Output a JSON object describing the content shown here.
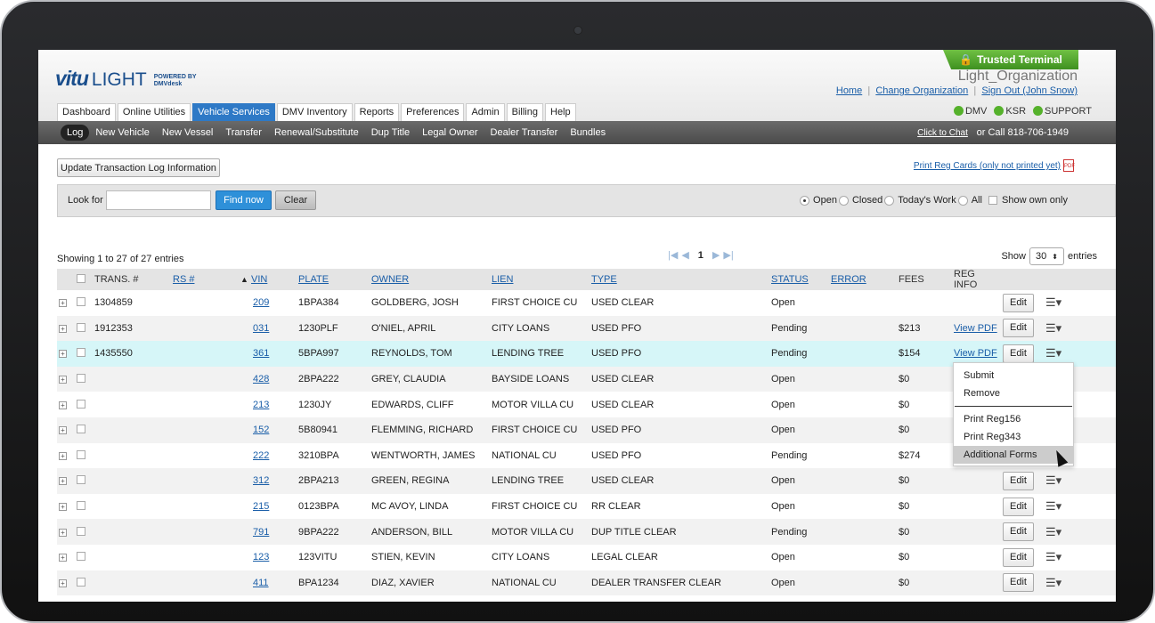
{
  "header": {
    "logo_main": "vitu",
    "logo_light": "LIGHT",
    "logo_powered": "POWERED BY",
    "logo_dmv": "DMVdesk",
    "trusted": "Trusted Terminal",
    "org": "Light_Organization",
    "links": {
      "home": "Home",
      "change_org": "Change Organization",
      "sign_out": "Sign Out (John Snow)"
    },
    "tabs": [
      "Dashboard",
      "Online Utilities",
      "Vehicle Services",
      "DMV Inventory",
      "Reports",
      "Preferences",
      "Admin",
      "Billing",
      "Help"
    ],
    "status": [
      "DMV",
      "KSR",
      "SUPPORT"
    ]
  },
  "subnav": {
    "items": [
      "Log",
      "New Vehicle",
      "New Vessel",
      "Transfer",
      "Renewal/Substitute",
      "Dup Title",
      "Legal Owner",
      "Dealer Transfer",
      "Bundles"
    ],
    "chat_link": "Click to Chat",
    "chat_rest": "or Call 818-706-1949"
  },
  "toolbar": {
    "update_btn": "Update Transaction Log Information",
    "print_reg": "Print Reg Cards (only not printed yet)"
  },
  "search": {
    "label": "Look for",
    "value": "",
    "find": "Find now",
    "clear": "Clear",
    "filters": [
      "Open",
      "Closed",
      "Today's Work",
      "All"
    ],
    "show_own": "Show own only"
  },
  "list": {
    "showing": "Showing 1 to 27 of 27 entries",
    "page": "1",
    "show": "Show",
    "per_page": "30",
    "entries": "entries"
  },
  "columns": [
    "TRANS. #",
    "RS #",
    "VIN",
    "PLATE",
    "OWNER",
    "LIEN",
    "TYPE",
    "STATUS",
    "ERROR",
    "FEES",
    "REG INFO"
  ],
  "rows": [
    {
      "trans": "1304859",
      "vin": "209",
      "plate": "1BPA384",
      "owner": "GOLDBERG, JOSH",
      "lien": "FIRST CHOICE CU",
      "type": "USED CLEAR",
      "status": "Open",
      "fees": "",
      "reg": ""
    },
    {
      "trans": "1912353",
      "vin": "031",
      "plate": "1230PLF",
      "owner": "O'NIEL, APRIL",
      "lien": "CITY LOANS",
      "type": "USED PFO",
      "status": "Pending",
      "fees": "$213",
      "reg": "View PDF"
    },
    {
      "trans": "1435550",
      "vin": "361",
      "plate": "5BPA997",
      "owner": "REYNOLDS, TOM",
      "lien": "LENDING TREE",
      "type": "USED PFO",
      "status": "Pending",
      "fees": "$154",
      "reg": "View PDF"
    },
    {
      "trans": "",
      "vin": "428",
      "plate": "2BPA222",
      "owner": "GREY, CLAUDIA",
      "lien": "BAYSIDE LOANS",
      "type": "USED CLEAR",
      "status": "Open",
      "fees": "$0",
      "reg": ""
    },
    {
      "trans": "",
      "vin": "213",
      "plate": "1230JY",
      "owner": "EDWARDS, CLIFF",
      "lien": "MOTOR VILLA CU",
      "type": "USED CLEAR",
      "status": "Open",
      "fees": "$0",
      "reg": ""
    },
    {
      "trans": "",
      "vin": "152",
      "plate": "5B80941",
      "owner": "FLEMMING, RICHARD",
      "lien": "FIRST CHOICE CU",
      "type": "USED PFO",
      "status": "Open",
      "fees": "$0",
      "reg": ""
    },
    {
      "trans": "",
      "vin": "222",
      "plate": "3210BPA",
      "owner": "WENTWORTH, JAMES",
      "lien": "NATIONAL CU",
      "type": "USED PFO",
      "status": "Pending",
      "fees": "$274",
      "reg": ""
    },
    {
      "trans": "",
      "vin": "312",
      "plate": "2BPA213",
      "owner": "GREEN, REGINA",
      "lien": "LENDING TREE",
      "type": "USED CLEAR",
      "status": "Open",
      "fees": "$0",
      "reg": ""
    },
    {
      "trans": "",
      "vin": "215",
      "plate": "0123BPA",
      "owner": "MC AVOY, LINDA",
      "lien": "FIRST CHOICE CU",
      "type": "RR CLEAR",
      "status": "Open",
      "fees": "$0",
      "reg": ""
    },
    {
      "trans": "",
      "vin": "791",
      "plate": "9BPA222",
      "owner": "ANDERSON, BILL",
      "lien": "MOTOR VILLA CU",
      "type": "DUP TITLE CLEAR",
      "status": "Pending",
      "fees": "$0",
      "reg": ""
    },
    {
      "trans": "",
      "vin": "123",
      "plate": "123VITU",
      "owner": "STIEN, KEVIN",
      "lien": "CITY LOANS",
      "type": "LEGAL CLEAR",
      "status": "Open",
      "fees": "$0",
      "reg": ""
    },
    {
      "trans": "",
      "vin": "411",
      "plate": "BPA1234",
      "owner": "DIAZ, XAVIER",
      "lien": "NATIONAL CU",
      "type": "DEALER TRANSFER CLEAR",
      "status": "Open",
      "fees": "$0",
      "reg": ""
    }
  ],
  "edit_label": "Edit",
  "dropdown": [
    "Submit",
    "Remove",
    "Print Reg156",
    "Print Reg343",
    "Additional Forms"
  ]
}
